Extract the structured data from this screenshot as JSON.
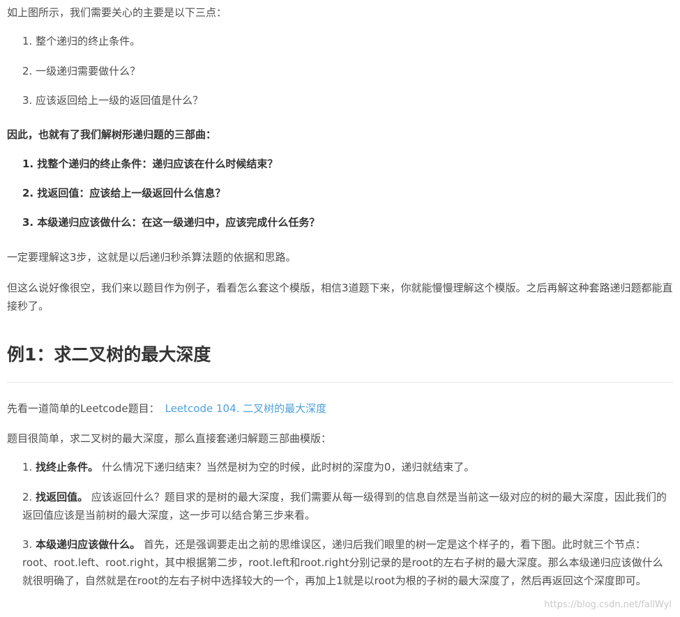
{
  "intro": "如上图所示，我们需要关心的主要是以下三点：",
  "points": [
    "1. 整个递归的终止条件。",
    "2. 一级递归需要做什么？",
    "3. 应该返回给上一级的返回值是什么？"
  ],
  "three_steps_title": "因此，也就有了我们解树形递归题的三部曲：",
  "three_steps": [
    "1. 找整个递归的终止条件：递归应该在什么时候结束？",
    "2. 找返回值：应该给上一级返回什么信息？",
    "3. 本级递归应该做什么：在这一级递归中，应该完成什么任务？"
  ],
  "para1": "一定要理解这3步，这就是以后递归秒杀算法题的依据和思路。",
  "para2": "但这么说好像很空，我们来以题目作为例子，看看怎么套这个模版，相信3道题下来，你就能慢慢理解这个模版。之后再解这种套路递归题都能直接秒了。",
  "example_heading": "例1：求二叉树的最大深度",
  "see_text": "先看一道简单的Leetcode题目：",
  "link_text": "Leetcode 104. 二叉树的最大深度",
  "simple_text": "题目很简单，求二叉树的最大深度，那么直接套递归解题三部曲模版：",
  "steps": [
    {
      "num": "1.",
      "label": "找终止条件。",
      "text": " 什么情况下递归结束？当然是树为空的时候，此时树的深度为0，递归就结束了。"
    },
    {
      "num": "2.",
      "label": "找返回值。",
      "text": " 应该返回什么？题目求的是树的最大深度，我们需要从每一级得到的信息自然是当前这一级对应的树的最大深度，因此我们的返回值应该是当前树的最大深度，这一步可以结合第三步来看。"
    },
    {
      "num": "3.",
      "label": "本级递归应该做什么。",
      "text": " 首先，还是强调要走出之前的思维误区，递归后我们眼里的树一定是这个样子的，看下图。此时就三个节点：root、root.left、root.right，其中根据第二步，root.left和root.right分别记录的是root的左右子树的最大深度。那么本级递归应该做什么就很明确了，自然就是在root的左右子树中选择较大的一个，再加上1就是以root为根的子树的最大深度了，然后再返回这个深度即可。"
    }
  ],
  "watermark": "https://blog.csdn.net/fallWyl"
}
